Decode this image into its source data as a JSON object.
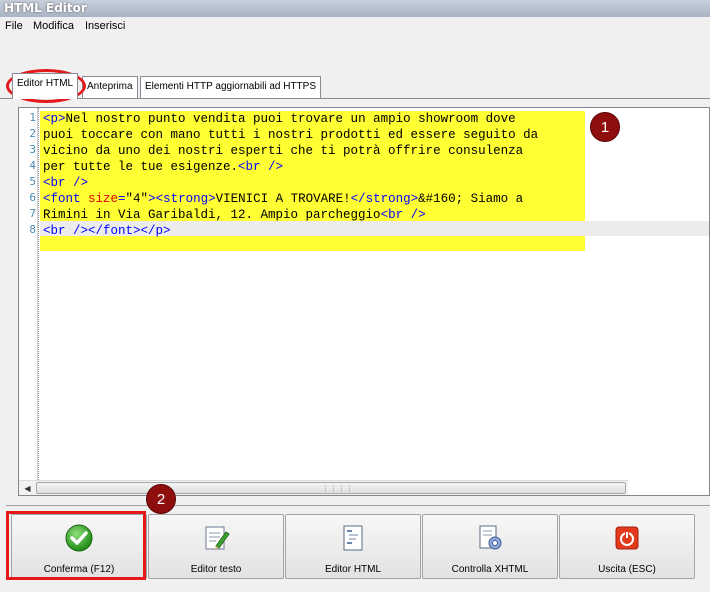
{
  "window": {
    "title": "HTML Editor"
  },
  "menu": {
    "items": [
      "File",
      "Modifica",
      "Inserisci"
    ]
  },
  "tabs": [
    {
      "label": "Editor HTML",
      "active": true
    },
    {
      "label": "Anteprima",
      "active": false
    },
    {
      "label": "Elementi HTTP aggiornabili ad HTTPS",
      "active": false
    }
  ],
  "editor": {
    "line_numbers": [
      "1",
      "2",
      "3",
      "4",
      "5",
      "6",
      "7",
      "8"
    ],
    "lines": [
      "<p>Nel nostro punto vendita puoi trovare un ampio showroom dove",
      "puoi toccare con mano tutti i nostri prodotti ed essere seguito da",
      "vicino da uno dei nostri esperti che ti potrà offrire consulenza",
      "per tutte le tue esigenze.<br />",
      "<br />",
      "<font size=\"4\"><strong>VIENICI A TROVARE!</strong>&#160; Siamo a",
      "Rimini in Via Garibaldi, 12. Ampio parcheggio<br />",
      "<br /></font></p>"
    ],
    "highlight_color": "#ffff33",
    "tag_color": "#0000ff",
    "attr_color": "#e00000"
  },
  "annotations": {
    "badge_1": "1",
    "badge_2": "2",
    "highlight_color": "#e3191c",
    "badge_color": "#8e0d0d"
  },
  "buttons": [
    {
      "label": "Conferma (F12)",
      "icon": "check-icon"
    },
    {
      "label": "Editor testo",
      "icon": "text-edit-icon"
    },
    {
      "label": "Editor HTML",
      "icon": "html-document-icon"
    },
    {
      "label": "Controlla XHTML",
      "icon": "document-gear-icon"
    },
    {
      "label": "Uscita (ESC)",
      "icon": "power-icon"
    }
  ]
}
